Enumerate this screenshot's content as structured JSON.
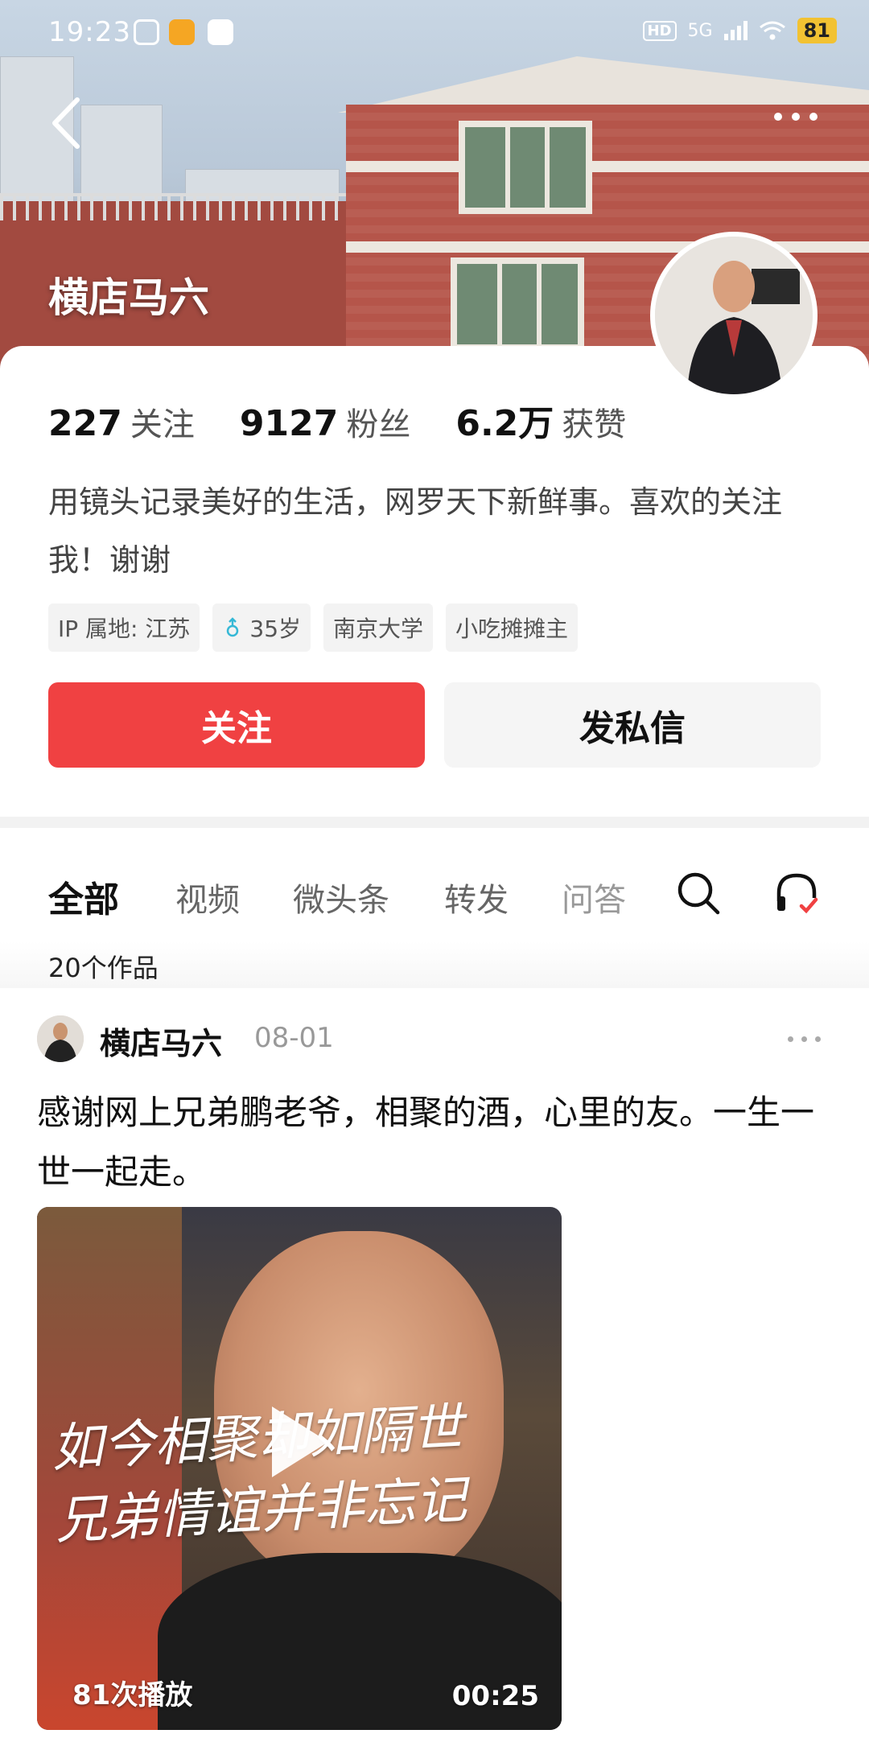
{
  "status_bar": {
    "time": "19:23",
    "network": "5G",
    "hd_badge": "HD",
    "battery": "81"
  },
  "profile": {
    "name": "横店马六",
    "stats": [
      {
        "value": "227",
        "label": "关注"
      },
      {
        "value": "9127",
        "label": "粉丝"
      },
      {
        "value": "6.2万",
        "label": "获赞"
      }
    ],
    "bio": "用镜头记录美好的生活，网罗天下新鲜事。喜欢的关注我！谢谢",
    "tags": [
      {
        "text": "IP 属地: 江苏"
      },
      {
        "text": "35岁",
        "icon": "male-icon"
      },
      {
        "text": "南京大学"
      },
      {
        "text": "小吃摊摊主"
      }
    ],
    "follow_label": "关注",
    "message_label": "发私信",
    "accent_color": "#f04142"
  },
  "tabs": {
    "items": [
      "全部",
      "视频",
      "微头条",
      "转发",
      "问答"
    ],
    "active": "全部",
    "works_count": "20个作品"
  },
  "post": {
    "author": "横店马六",
    "date": "08-01",
    "text": "感谢网上兄弟鹏老爷，相聚的酒，心里的友。一生一世一起走。",
    "video": {
      "caption_line1": "如今相聚却如隔世",
      "caption_line2": "兄弟情谊并非忘记",
      "plays": "81次播放",
      "duration": "00:25"
    }
  }
}
